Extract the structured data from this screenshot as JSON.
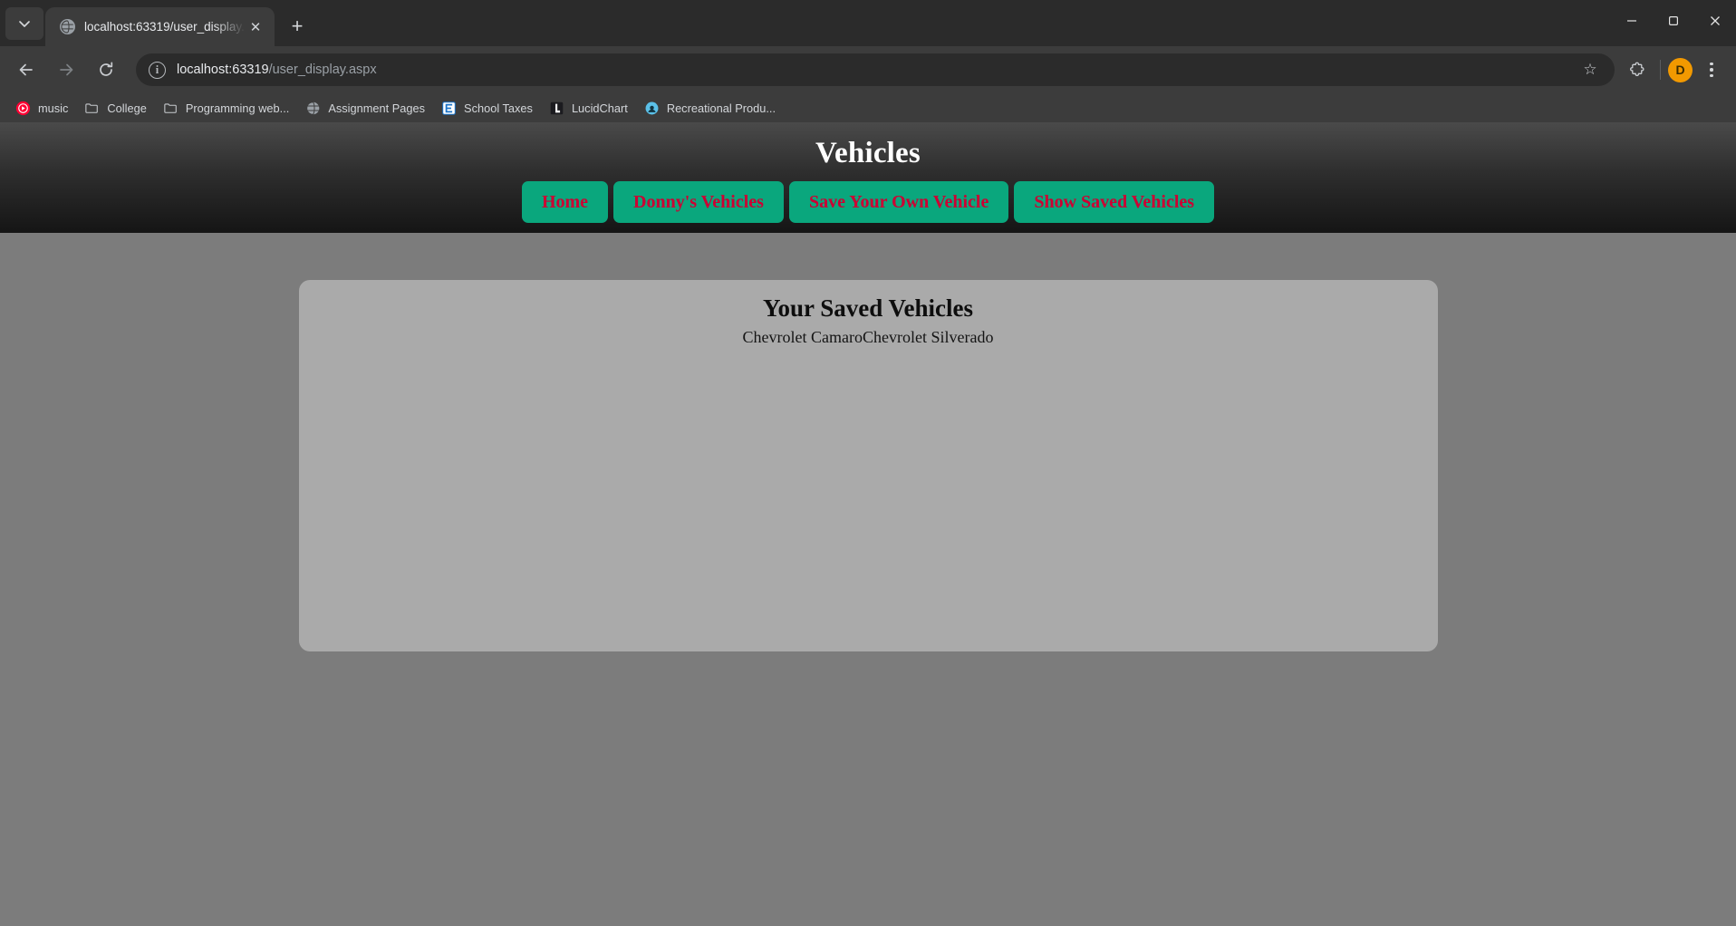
{
  "browser": {
    "tab": {
      "title": "localhost:63319/user_display.as",
      "favicon": "globe-icon",
      "close_label": "✕"
    },
    "new_tab_label": "+",
    "tab_search_label": "tab-search",
    "window_controls": {
      "minimize": "minimize",
      "maximize": "maximize",
      "close": "close"
    },
    "toolbar": {
      "back_label": "Back",
      "forward_label": "Forward",
      "reload_label": "Reload",
      "site_info_label": "i",
      "url_host": "localhost:63319",
      "url_path": "/user_display.aspx",
      "url_full": "localhost:63319/user_display.aspx",
      "bookmark_star_label": "☆",
      "extensions_label": "Extensions",
      "profile_initial": "D",
      "menu_label": "Customize and control"
    },
    "bookmarks": [
      {
        "label": "music",
        "icon": "youtube-music-icon"
      },
      {
        "label": "College",
        "icon": "folder-icon"
      },
      {
        "label": "Programming web...",
        "icon": "folder-icon"
      },
      {
        "label": "Assignment Pages",
        "icon": "globe-icon"
      },
      {
        "label": "School Taxes",
        "icon": "edgenuity-e-icon"
      },
      {
        "label": "LucidChart",
        "icon": "lucidchart-icon"
      },
      {
        "label": "Recreational Produ...",
        "icon": "blue-circle-icon"
      }
    ]
  },
  "page": {
    "header": {
      "title": "Vehicles",
      "nav": [
        {
          "label": "Home"
        },
        {
          "label": "Donny's Vehicles"
        },
        {
          "label": "Save Your Own Vehicle"
        },
        {
          "label": "Show Saved Vehicles"
        }
      ]
    },
    "card": {
      "title": "Your Saved Vehicles",
      "vehicles_text": "Chevrolet CamaroChevrolet Silverado",
      "vehicles": [
        "Chevrolet Camaro",
        "Chevrolet Silverado"
      ]
    }
  },
  "colors": {
    "nav_button_bg": "#0aa77d",
    "nav_button_text": "#cc0033",
    "page_bg": "#7c7c7c",
    "card_bg": "#aaaaaa",
    "header_text": "#ffffff",
    "profile_bg": "#f29900"
  }
}
